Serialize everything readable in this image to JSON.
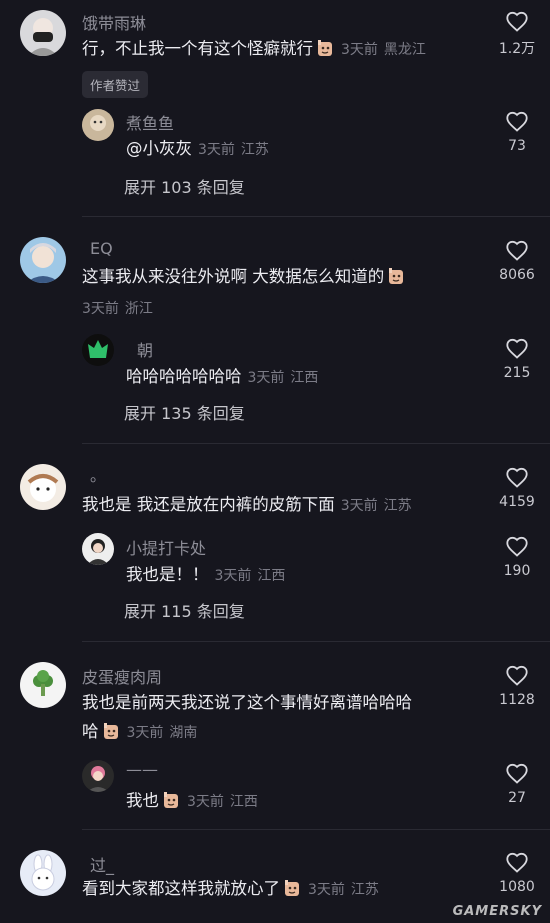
{
  "comments": [
    {
      "username": "饿带雨琳",
      "text": "行，不止我一个有这个怪癖就行",
      "time": "3天前",
      "location": "黑龙江",
      "likes": "1.2万",
      "badge": "作者赞过",
      "reply": {
        "username": "煮鱼鱼",
        "text": "@小灰灰",
        "time": "3天前",
        "location": "江苏",
        "likes": "73"
      },
      "expand": "展开 103 条回复"
    },
    {
      "username": "EQ",
      "text": "这事我从来没往外说啊 大数据怎么知道的",
      "time": "3天前",
      "location": "浙江",
      "likes": "8066",
      "reply": {
        "username": "朝",
        "text": "哈哈哈哈哈哈哈",
        "time": "3天前",
        "location": "江西",
        "likes": "215"
      },
      "expand": "展开 135 条回复"
    },
    {
      "username": "。",
      "text": "我也是  我还是放在内裤的皮筋下面",
      "time": "3天前",
      "location": "江苏",
      "likes": "4159",
      "reply": {
        "username": "小提打卡处",
        "text": "我也是！！",
        "time": "3天前",
        "location": "江西",
        "likes": "190"
      },
      "expand": "展开 115 条回复"
    },
    {
      "username": "皮蛋瘦肉周",
      "text": "我也是前两天我还说了这个事情好离谱哈哈哈",
      "text2": "哈",
      "time": "3天前",
      "location": "湖南",
      "likes": "1128",
      "reply": {
        "username": "——",
        "text": "我也",
        "time": "3天前",
        "location": "江西",
        "likes": "27"
      }
    },
    {
      "username": "过_",
      "text": "看到大家都这样我就放心了",
      "time": "3天前",
      "location": "江苏",
      "likes": "1080"
    }
  ],
  "watermark": "GAMERSKY",
  "colors": {
    "background": "#16161e",
    "text": "#ececf1",
    "muted": "#7c7c87"
  }
}
